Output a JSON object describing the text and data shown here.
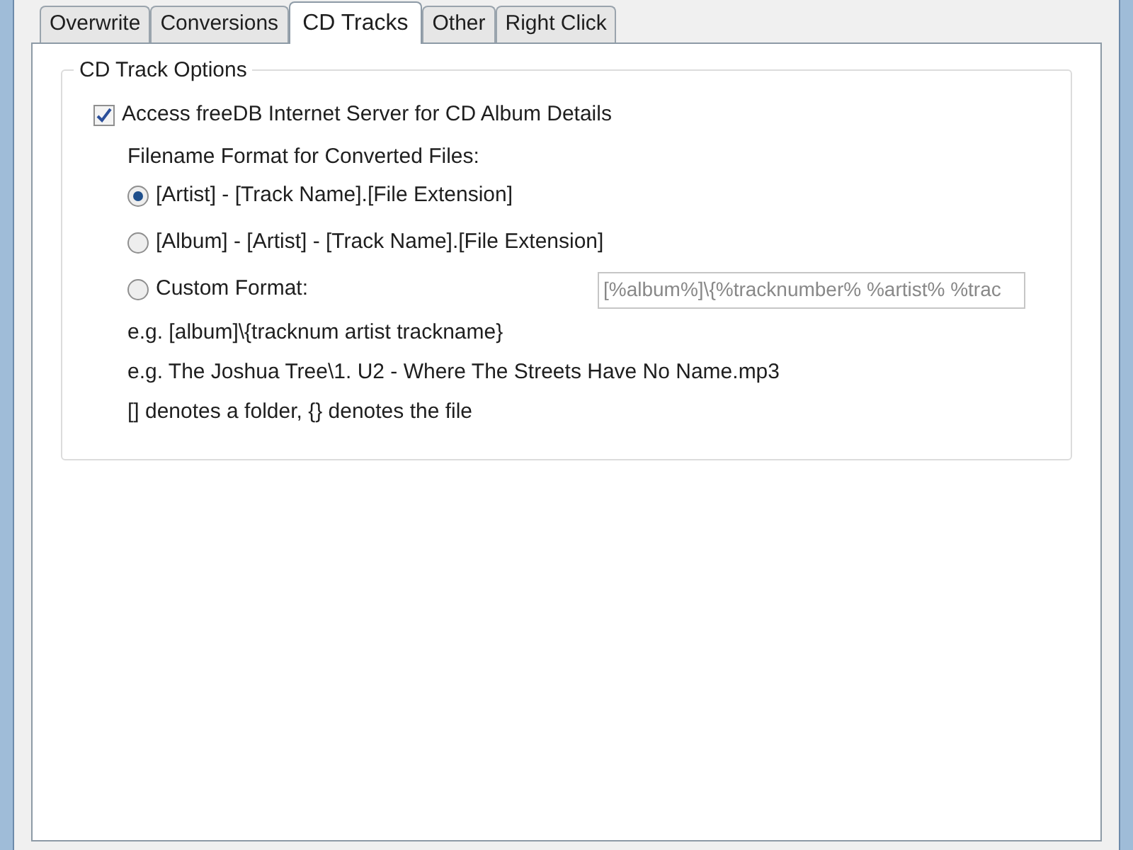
{
  "tabs": [
    {
      "label": "Overwrite",
      "selected": false
    },
    {
      "label": "Conversions",
      "selected": false
    },
    {
      "label": "CD Tracks",
      "selected": true
    },
    {
      "label": "Other",
      "selected": false
    },
    {
      "label": "Right Click",
      "selected": false
    }
  ],
  "group": {
    "title": "CD Track Options",
    "freedb": {
      "label": "Access freeDB Internet Server for CD Album Details",
      "checked": true
    },
    "format_label": "Filename Format for Converted Files:",
    "formats": [
      {
        "label": "[Artist] - [Track Name].[File Extension]",
        "selected": true
      },
      {
        "label": "[Album] - [Artist] - [Track Name].[File Extension]",
        "selected": false
      },
      {
        "label": "Custom Format:",
        "selected": false
      }
    ],
    "custom_value": "[%album%]\\{%tracknumber% %artist% %trac",
    "notes": [
      "e.g. [album]\\{tracknum artist trackname}",
      "e.g. The Joshua Tree\\1. U2 - Where The Streets Have No Name.mp3",
      "[] denotes a folder, {} denotes the file"
    ]
  }
}
